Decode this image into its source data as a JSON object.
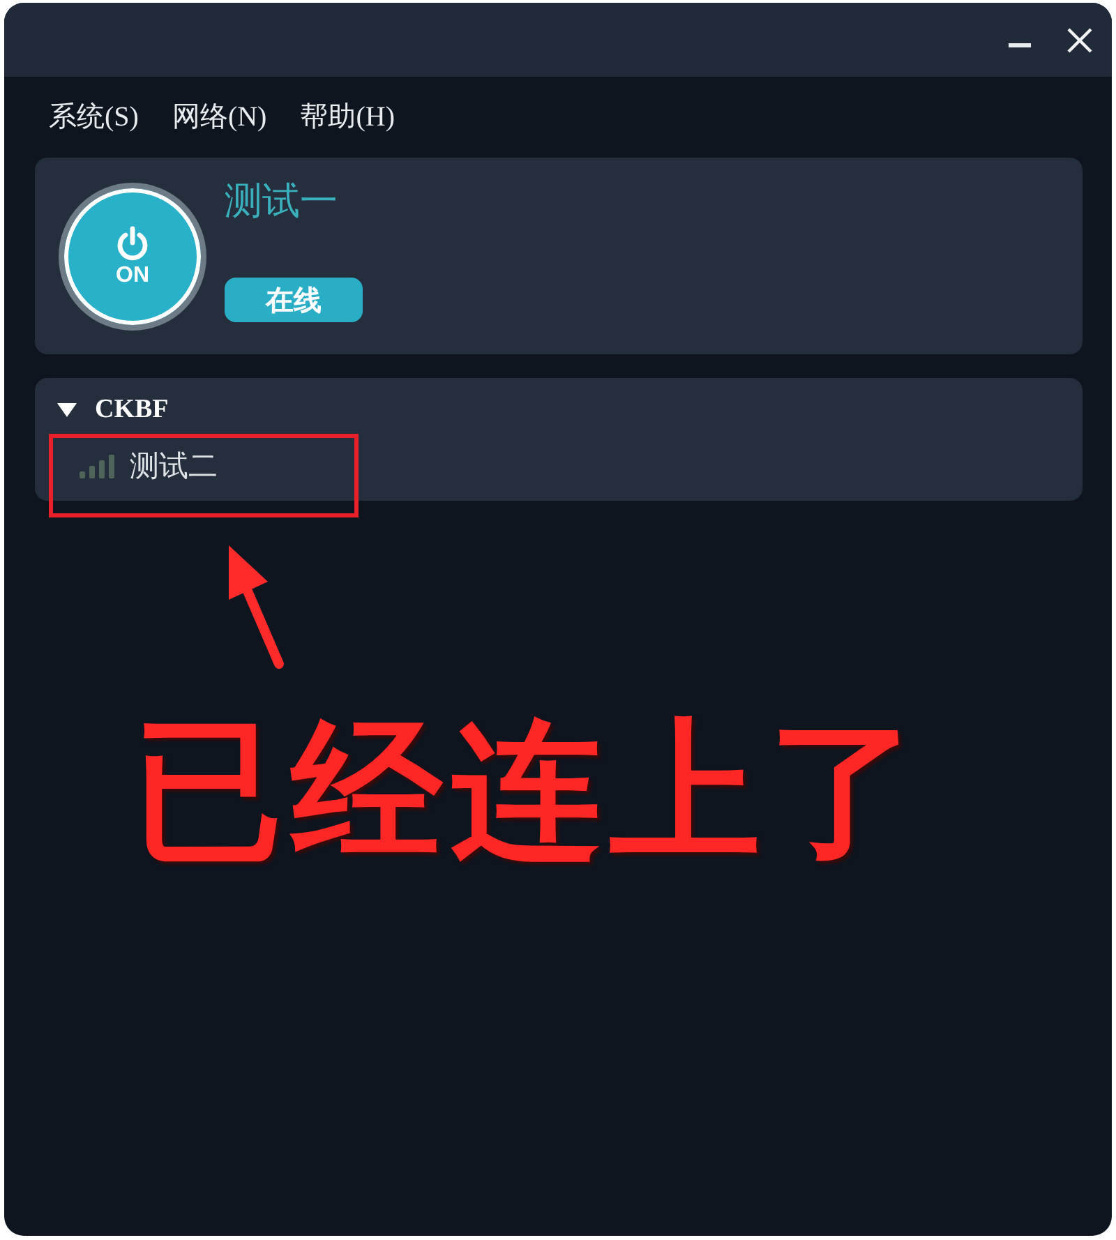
{
  "menu": [
    "系统(S)",
    "网络(N)",
    "帮助(H)"
  ],
  "current_device": {
    "name": "测试一",
    "power": {
      "label": "ON",
      "on": true
    },
    "status": "在线"
  },
  "groups": [
    {
      "name": "CKBF",
      "expanded": true,
      "children": [
        {
          "name": "测试二"
        }
      ]
    }
  ],
  "annotation": {
    "text": "已经连上了"
  }
}
